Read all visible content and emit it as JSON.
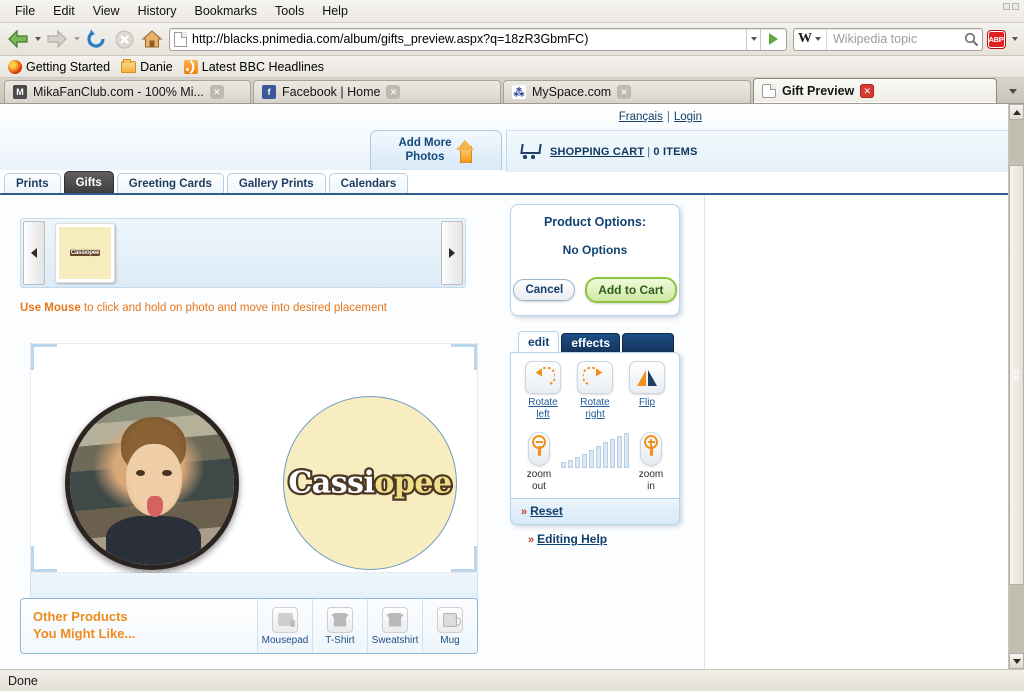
{
  "browser": {
    "menu": [
      "File",
      "Edit",
      "View",
      "History",
      "Bookmarks",
      "Tools",
      "Help"
    ],
    "url": "http://blacks.pnimedia.com/album/gifts_preview.aspx?q=18zR3GbmFC)",
    "search": {
      "engine": "W",
      "placeholder": "Wikipedia topic"
    },
    "adblock_label": "ABP",
    "bookmarks": [
      {
        "label": "Getting Started",
        "icon": "firefox-icon"
      },
      {
        "label": "Danie",
        "icon": "folder-icon"
      },
      {
        "label": "Latest BBC Headlines",
        "icon": "rss-icon"
      }
    ],
    "tabs": [
      {
        "label": "MikaFanClub.com - 100% Mi...",
        "favicon": "mika-icon",
        "active": false
      },
      {
        "label": "Facebook | Home",
        "favicon": "facebook-icon",
        "active": false
      },
      {
        "label": "MySpace.com",
        "favicon": "myspace-icon",
        "active": false
      },
      {
        "label": "Gift Preview",
        "favicon": "document-icon",
        "active": true
      }
    ],
    "status": "Done"
  },
  "site": {
    "lang_link": "Français",
    "separator": "|",
    "login_link": "Login",
    "add_more_photos": "Add More\nPhotos",
    "add_more_photos_l1": "Add More",
    "add_more_photos_l2": "Photos",
    "cart": {
      "label": "SHOPPING CART",
      "divider": "|",
      "count": "0",
      "unit": "ITEMS"
    },
    "product_tabs": [
      {
        "label": "Prints",
        "active": false
      },
      {
        "label": "Gifts",
        "active": true
      },
      {
        "label": "Greeting Cards",
        "active": false
      },
      {
        "label": "Gallery Prints",
        "active": false
      },
      {
        "label": "Calendars",
        "active": false
      }
    ]
  },
  "editor": {
    "filmstrip": {
      "prev_arrow": "◀",
      "next_arrow": "▶",
      "thumbnails": [
        {
          "caption": "Cassiopee"
        }
      ]
    },
    "hint_bold": "Use Mouse",
    "hint_rest": " to click and hold on photo and move into desired placement",
    "badges": [
      {
        "name": "photo-badge",
        "caption": ""
      },
      {
        "name": "logo-badge",
        "logo_part_1": "Cassi",
        "logo_part_2": "opee"
      }
    ],
    "other_products": {
      "title_l1": "Other Products",
      "title_l2": "You Might Like...",
      "items": [
        {
          "label": "Mousepad",
          "icon": "mousepad-icon"
        },
        {
          "label": "T-Shirt",
          "icon": "tshirt-icon"
        },
        {
          "label": "Sweatshirt",
          "icon": "sweatshirt-icon"
        },
        {
          "label": "Mug",
          "icon": "mug-icon"
        }
      ]
    }
  },
  "options": {
    "title": "Product Options:",
    "none": "No Options",
    "cancel_label": "Cancel",
    "add_to_cart_label": "Add to Cart",
    "tabs": [
      {
        "label": "edit",
        "active": true
      },
      {
        "label": "effects",
        "active": false
      },
      {
        "label": "",
        "active": false
      }
    ],
    "tools": [
      {
        "label_l1": "Rotate",
        "label_l2": "left",
        "icon": "rotate-left-icon"
      },
      {
        "label_l1": "Rotate",
        "label_l2": "right",
        "icon": "rotate-right-icon"
      },
      {
        "label_l1": "Flip",
        "label_l2": "",
        "icon": "flip-icon"
      }
    ],
    "zoom_out_l1": "zoom",
    "zoom_out_l2": "out",
    "zoom_in_l1": "zoom",
    "zoom_in_l2": "in",
    "reset_label": "Reset",
    "reset_chevron": "»",
    "help_label": "Editing Help",
    "help_chevron": "»"
  },
  "colors": {
    "accent_orange": "#ef8a1c",
    "link_blue": "#11406c",
    "cart_green": "#8dc63f",
    "badge_yellow": "#f7edc0",
    "logo_brown": "#4a3724"
  }
}
